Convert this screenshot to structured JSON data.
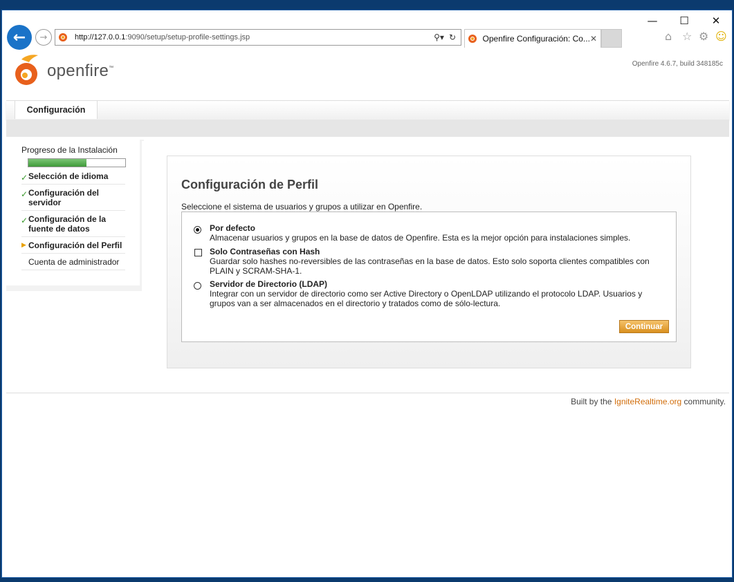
{
  "browser": {
    "url_host": "http://127.0.0.1",
    "url_rest": ":9090/setup/setup-profile-settings.jsp",
    "tab_title": "Openfire Configuración: Co...",
    "minimize_glyph": "—",
    "maximize_glyph": "☐",
    "close_glyph": "✕"
  },
  "header": {
    "brand": "openfire",
    "trademark": "™",
    "version": "Openfire 4.6.7, build 348185c",
    "nav_tab": "Configuración"
  },
  "sidebar": {
    "title": "Progreso de la Instalación",
    "progress": 0.6,
    "steps": [
      {
        "label": "Selección de idioma",
        "status": "done"
      },
      {
        "label": "Configuración del servidor",
        "status": "done"
      },
      {
        "label": "Configuración de la fuente de datos",
        "status": "done"
      },
      {
        "label": "Configuración del Perfil",
        "status": "current"
      },
      {
        "label": "Cuenta de administrador",
        "status": "pending"
      }
    ]
  },
  "main": {
    "title": "Configuración de Perfil",
    "description": "Seleccione el sistema de usuarios y grupos a utilizar en Openfire.",
    "options": [
      {
        "title": "Por defecto",
        "desc": "Almacenar usuarios y grupos en la base de datos de Openfire. Esta es la mejor opción para instalaciones simples.",
        "selected": true
      },
      {
        "title": "Solo Contraseñas con Hash",
        "desc": "Guardar solo hashes no-reversibles de las contraseñas en la base de datos. Esto solo soporta clientes compatibles con PLAIN y SCRAM-SHA-1.",
        "checked": false
      },
      {
        "title": "Servidor de Directorio (LDAP)",
        "desc": "Integrar con un servidor de directorio como ser Active Directory o OpenLDAP utilizando el protocolo LDAP. Usuarios y grupos van a ser almacenados en el directorio y tratados como de sólo-lectura.",
        "selected": false
      }
    ],
    "continue_label": "Continuar"
  },
  "footer": {
    "prefix": "Built by the ",
    "link": "IgniteRealtime.org",
    "suffix": " community."
  },
  "colors": {
    "accent": "#d9901f",
    "link": "#d16d0a",
    "progress": "#3f9a3a",
    "browser_blue": "#1a73c8"
  }
}
